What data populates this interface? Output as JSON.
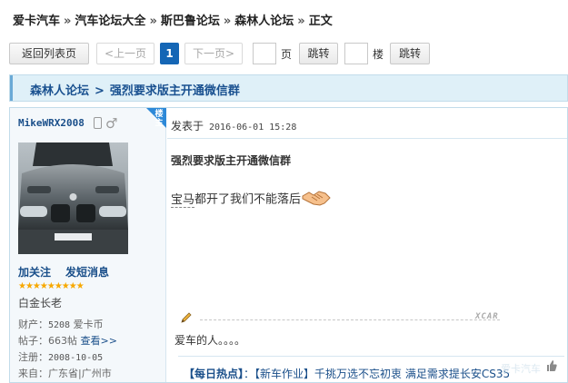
{
  "breadcrumb": {
    "site": "爱卡汽车",
    "forums": "汽车论坛大全",
    "brand": "斯巴鲁论坛",
    "sub": "森林人论坛",
    "current": "正文",
    "separator": "»"
  },
  "pager": {
    "back": "返回列表页",
    "prev": "<上一页",
    "current_page": "1",
    "next": "下一页>",
    "page_unit": "页",
    "jump": "跳转",
    "floor_unit": "楼",
    "jump2": "跳转"
  },
  "thread": {
    "forum": "森林人论坛",
    "separator": ">",
    "title": "强烈要求版主开通微信群"
  },
  "author": {
    "username": "MikeWRX2008",
    "louzhu": "楼主",
    "follow": "加关注",
    "message": "发短消息",
    "stars": "★★★★★★★★★",
    "rank": "白金长老",
    "wealth_label": "财产：",
    "wealth_value": "5208",
    "wealth_unit": "爱卡币",
    "posts_label": "帖子：",
    "posts_value": "663帖",
    "posts_link": "查看>>",
    "reg_label": "注册：",
    "reg_value": "2008-10-05",
    "from_label": "来自：",
    "from_value": "广东省|广州市"
  },
  "post": {
    "posted_label": "发表于",
    "timestamp": "2016-06-01 15:28",
    "title": "强烈要求版主开通微信群",
    "body_underlined": "宝马",
    "body_rest": "都开了我们不能落后",
    "watermark": "XCAR",
    "signature": "爱车的人。。。。",
    "hot_label": "【每日热点】",
    "hot_colon": "：",
    "hot_link": "【新车作业】千挑万选不忘初衷 满足需求提长安CS35"
  },
  "ghost_text": "爱卡汽车"
}
